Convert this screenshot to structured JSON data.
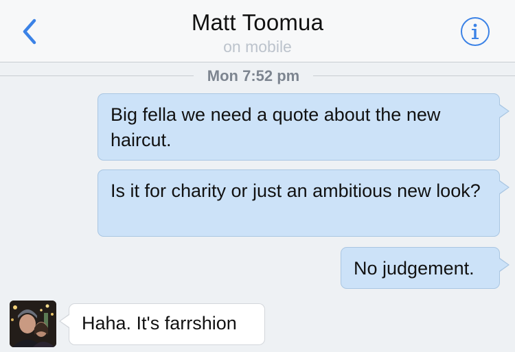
{
  "header": {
    "back_icon": "chevron-left-icon",
    "contact_name": "Matt Toomua",
    "status": "on mobile",
    "info_icon": "info-icon",
    "accent_color": "#3b82e6"
  },
  "conversation": {
    "timestamp": "Mon 7:52 pm",
    "messages": [
      {
        "direction": "outgoing",
        "text": "Big fella we need a quote about the new haircut."
      },
      {
        "direction": "outgoing",
        "text": "Is it for charity or just an ambitious new look?"
      },
      {
        "direction": "outgoing",
        "text": "No judgement."
      },
      {
        "direction": "incoming",
        "text": "Haha. It's farrshion"
      }
    ]
  },
  "colors": {
    "outgoing_bubble": "#cce2f8",
    "incoming_bubble": "#ffffff",
    "background": "#eef1f4"
  }
}
